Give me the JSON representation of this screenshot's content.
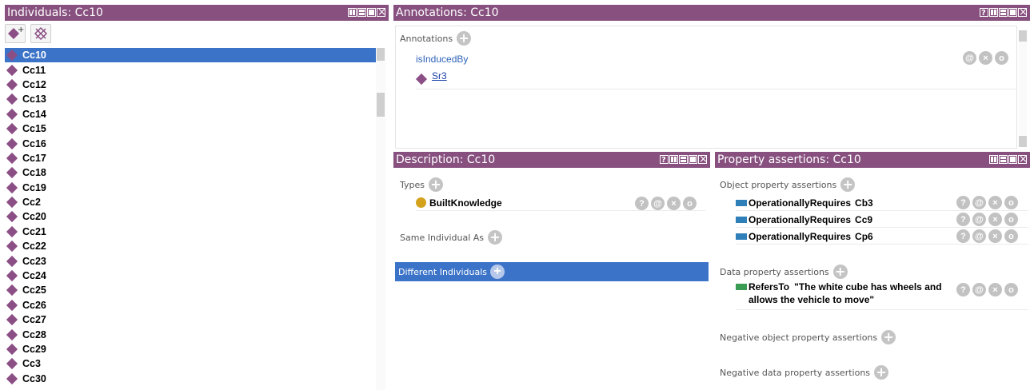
{
  "individuals": {
    "title": "Individuals: Cc10",
    "toolbar": {
      "add_icon": "add-individual-icon",
      "delete_icon": "delete-individual-icon"
    },
    "items": [
      "Cc10",
      "Cc11",
      "Cc12",
      "Cc13",
      "Cc14",
      "Cc15",
      "Cc16",
      "Cc17",
      "Cc18",
      "Cc19",
      "Cc2",
      "Cc20",
      "Cc21",
      "Cc22",
      "Cc23",
      "Cc24",
      "Cc25",
      "Cc26",
      "Cc27",
      "Cc28",
      "Cc29",
      "Cc3",
      "Cc30"
    ],
    "selected": "Cc10"
  },
  "annotations": {
    "title": "Annotations: Cc10",
    "section_label": "Annotations",
    "property": "isInducedBy",
    "value": "Sr3"
  },
  "description": {
    "title": "Description: Cc10",
    "types_label": "Types",
    "type_value": "BuiltKnowledge",
    "same_label": "Same Individual As",
    "different_label": "Different Individuals"
  },
  "property_assertions": {
    "title": "Property assertions: Cc10",
    "object_label": "Object property assertions",
    "object_items": [
      {
        "property": "OperationallyRequires",
        "value": "Cb3"
      },
      {
        "property": "OperationallyRequires",
        "value": "Cc9"
      },
      {
        "property": "OperationallyRequires",
        "value": "Cp6"
      }
    ],
    "data_label": "Data property assertions",
    "data_item": {
      "property": "RefersTo",
      "value_line1": "\"The white cube has wheels and",
      "value_line2": "allows the vehicle to move\""
    },
    "neg_object_label": "Negative object property assertions",
    "neg_data_label": "Negative data property assertions"
  },
  "action_glyphs": {
    "help": "?",
    "annotate": "@",
    "delete": "×",
    "edit": "o"
  },
  "colors": {
    "titlebar": "#87507f",
    "selection": "#3b73c8",
    "individual": "#8b4f86",
    "class": "#d4a21b",
    "object_property": "#2f7fb9",
    "data_property": "#3a9c52"
  }
}
